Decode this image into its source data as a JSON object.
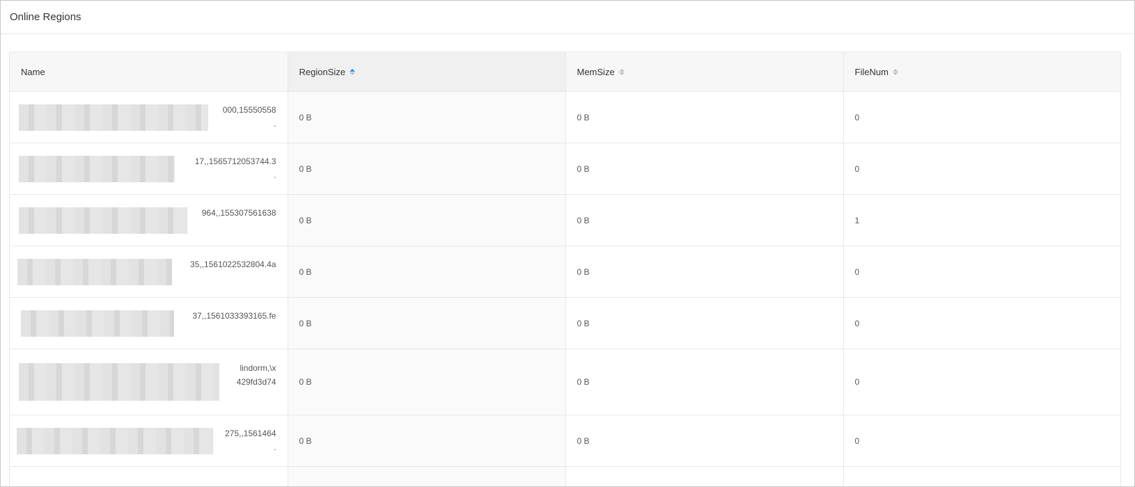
{
  "panel": {
    "title": "Online Regions"
  },
  "table": {
    "columns": [
      {
        "label": "Name",
        "sortable": false
      },
      {
        "label": "RegionSize",
        "sortable": true,
        "sort": "ascending"
      },
      {
        "label": "MemSize",
        "sortable": true,
        "sort": "none"
      },
      {
        "label": "FileNum",
        "sortable": true,
        "sort": "none"
      }
    ],
    "rows": [
      {
        "name_visible": "000,15550558\n.",
        "region_size": "0 B",
        "mem_size": "0 B",
        "file_num": "0"
      },
      {
        "name_visible": "17,,1565712053744.3\n.",
        "region_size": "0 B",
        "mem_size": "0 B",
        "file_num": "0"
      },
      {
        "name_visible": "964,,155307561638",
        "region_size": "0 B",
        "mem_size": "0 B",
        "file_num": "1"
      },
      {
        "name_visible": "35,,1561022532804.4a",
        "region_size": "0 B",
        "mem_size": "0 B",
        "file_num": "0"
      },
      {
        "name_visible": "37,,1561033393165.fe",
        "region_size": "0 B",
        "mem_size": "0 B",
        "file_num": "0"
      },
      {
        "name_visible": "lindorm,\\x\n429fd3d74",
        "region_size": "0 B",
        "mem_size": "0 B",
        "file_num": "0"
      },
      {
        "name_visible": "275,,1561464\n.",
        "region_size": "0 B",
        "mem_size": "0 B",
        "file_num": "0"
      }
    ]
  },
  "colors": {
    "sort_active": "#1890ff",
    "sort_inactive": "#bfbfbf",
    "header_bg": "#f7f7f7",
    "border": "#e8e8e8"
  }
}
